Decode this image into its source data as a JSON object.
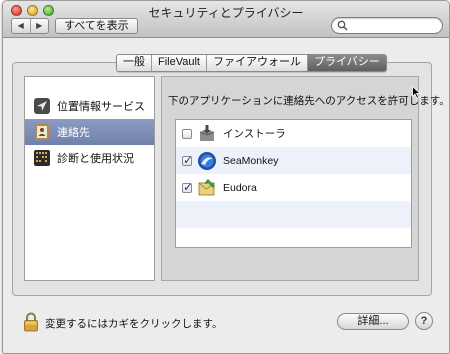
{
  "window": {
    "title": "セキュリティとプライバシー"
  },
  "toolbar": {
    "back_glyph": "◀",
    "forward_glyph": "▶",
    "show_all_label": "すべてを表示",
    "search_placeholder": "",
    "search_value": ""
  },
  "tabs": [
    {
      "label": "一般",
      "selected": false
    },
    {
      "label": "FileVault",
      "selected": false
    },
    {
      "label": "ファイアウォール",
      "selected": false
    },
    {
      "label": "プライバシー",
      "selected": true
    }
  ],
  "sidebar": {
    "items": [
      {
        "label": "位置情報サービス",
        "icon": "location-services-icon",
        "selected": false
      },
      {
        "label": "連絡先",
        "icon": "contacts-icon",
        "selected": true
      },
      {
        "label": "診断と使用状況",
        "icon": "diagnostics-icon",
        "selected": false
      }
    ]
  },
  "main": {
    "description": "下のアプリケーションに連絡先へのアクセスを許可します。",
    "apps": [
      {
        "name": "インストーラ",
        "checked": false,
        "icon": "installer-icon"
      },
      {
        "name": "SeaMonkey",
        "checked": true,
        "icon": "seamonkey-icon"
      },
      {
        "name": "Eudora",
        "checked": true,
        "icon": "eudora-icon"
      }
    ]
  },
  "footer": {
    "lock_text": "変更するにはカギをクリックします。",
    "details_label": "詳細...",
    "help_label": "?"
  },
  "colors": {
    "selected_row": "#7a89b4",
    "tab_active": "#6e6e6e",
    "checkmark": "#1d3a8a"
  }
}
